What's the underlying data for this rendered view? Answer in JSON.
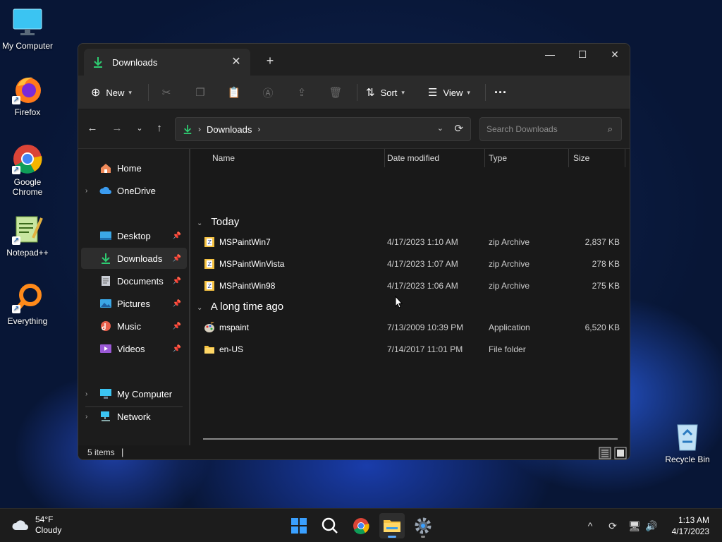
{
  "desktop": {
    "icons": [
      {
        "label": "My Computer"
      },
      {
        "label": "Firefox"
      },
      {
        "label": "Google Chrome"
      },
      {
        "label": "Notepad++"
      },
      {
        "label": "Everything"
      },
      {
        "label": "Recycle Bin"
      }
    ]
  },
  "window": {
    "tab_title": "Downloads",
    "new_tab": "+",
    "controls": {
      "minimize": "—",
      "maximize": "☐",
      "close": "✕"
    },
    "toolbar": {
      "new_label": "New",
      "sort_label": "Sort",
      "view_label": "View",
      "more": "···"
    },
    "address": {
      "crumbs": [
        "Downloads"
      ]
    },
    "search": {
      "placeholder": "Search Downloads"
    },
    "sidebar": {
      "items": [
        {
          "label": "Home"
        },
        {
          "label": "OneDrive"
        },
        {
          "label": "Desktop"
        },
        {
          "label": "Downloads"
        },
        {
          "label": "Documents"
        },
        {
          "label": "Pictures"
        },
        {
          "label": "Music"
        },
        {
          "label": "Videos"
        },
        {
          "label": "My Computer"
        },
        {
          "label": "Network"
        }
      ]
    },
    "columns": {
      "name": "Name",
      "date": "Date modified",
      "type": "Type",
      "size": "Size"
    },
    "groups": [
      {
        "title": "Today",
        "files": [
          {
            "name": "MSPaintWin7",
            "date": "4/17/2023 1:10 AM",
            "type": "zip Archive",
            "size": "2,837 KB"
          },
          {
            "name": "MSPaintWinVista",
            "date": "4/17/2023 1:07 AM",
            "type": "zip Archive",
            "size": "278 KB"
          },
          {
            "name": "MSPaintWin98",
            "date": "4/17/2023 1:06 AM",
            "type": "zip Archive",
            "size": "275 KB"
          }
        ]
      },
      {
        "title": "A long time ago",
        "files": [
          {
            "name": "mspaint",
            "date": "7/13/2009 10:39 PM",
            "type": "Application",
            "size": "6,520 KB"
          },
          {
            "name": "en-US",
            "date": "7/14/2017 11:01 PM",
            "type": "File folder",
            "size": ""
          }
        ]
      }
    ],
    "status": {
      "count": "5 items",
      "caret": "|"
    }
  },
  "taskbar": {
    "weather": {
      "temp": "54°F",
      "condition": "Cloudy"
    },
    "clock": {
      "time": "1:13 AM",
      "date": "4/17/2023"
    },
    "tray_chevron": "^"
  },
  "colors": {
    "accent": "#58a9ff",
    "download_green": "#2ecc71",
    "folder_yellow": "#f5c242"
  }
}
